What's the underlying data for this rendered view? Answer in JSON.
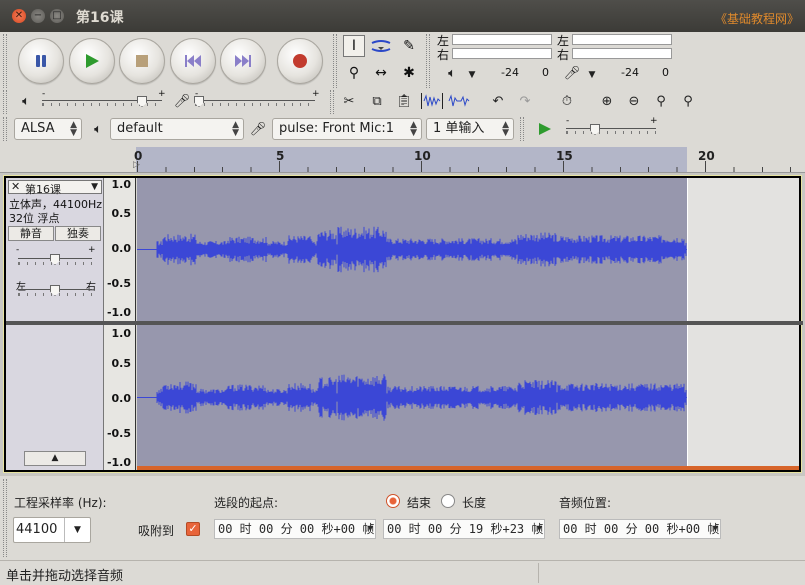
{
  "window": {
    "title": "第16课",
    "watermark": "《基础教程网》"
  },
  "transport": {
    "pause_icon": "pause-icon",
    "play_icon": "play-icon",
    "stop_icon": "stop-icon",
    "skip_start_icon": "skip-to-start-icon",
    "skip_end_icon": "skip-to-end-icon",
    "record_icon": "record-icon",
    "colors": {
      "play": "#2e9b2e",
      "record": "#c23b2e",
      "pause": "#3a57a8",
      "stop": "#b8a07a"
    }
  },
  "meters": {
    "left_label": "左",
    "right_label": "右",
    "playback_scale": [
      "-24",
      "0"
    ],
    "record_scale": [
      "-24",
      "0"
    ]
  },
  "mixer": {
    "output_slider_min": "-",
    "output_slider_max": "+",
    "input_slider_min": "-",
    "input_slider_max": "+"
  },
  "device": {
    "host": "ALSA",
    "output": "default",
    "input": "pulse: Front Mic:1",
    "channels": "1 单输入",
    "play_at_speed_min": "-",
    "play_at_speed_max": "+"
  },
  "ruler": {
    "labels": [
      "0",
      "5",
      "10",
      "15",
      "20"
    ]
  },
  "track": {
    "name": "第16课",
    "info_line1": "立体声，44100Hz",
    "info_line2": "32位 浮点",
    "mute": "静音",
    "solo": "独奏",
    "gain_min": "-",
    "gain_max": "+",
    "pan_left": "左",
    "pan_right": "右",
    "collapse_icon": "collapse-up-icon",
    "scale_labels": [
      "1.0",
      "0.5",
      "0.0",
      "-0.5",
      "-1.0"
    ],
    "wave_color": "#3b47d6",
    "selection_color": "#9797ad"
  },
  "selection_bar": {
    "rate_label": "工程采样率 (Hz):",
    "rate_value": "44100",
    "snap_label": "吸附到",
    "start_label": "选段的起点:",
    "end_option": "结束",
    "length_option": "长度",
    "position_label": "音频位置:",
    "start_time": "00 时 00 分 00 秒+00 帧",
    "end_time": "00 时 00 分 19 秒+23 帧",
    "position_time": "00 时 00 分 00 秒+00 帧"
  },
  "status": {
    "text": "单击并拖动选择音频"
  }
}
